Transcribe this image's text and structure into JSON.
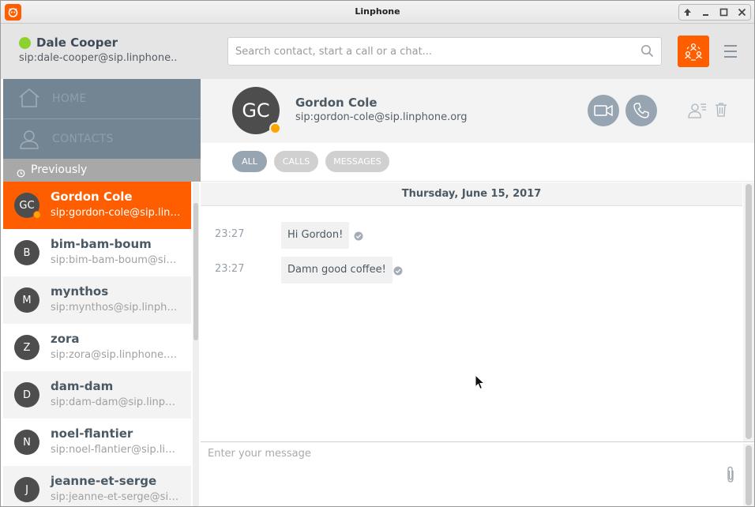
{
  "window": {
    "title": "Linphone"
  },
  "user": {
    "name": "Dale Cooper",
    "sip": "sip:dale-cooper@sip.linphone...."
  },
  "search": {
    "placeholder": "Search contact, start a call or a chat..."
  },
  "nav": {
    "home_label": "HOME",
    "contacts_label": "CONTACTS",
    "previously_label": "Previously"
  },
  "contacts": [
    {
      "initials": "GC",
      "name": "Gordon Cole",
      "sip": "sip:gordon-cole@sip.linphone.org",
      "selected": true
    },
    {
      "initials": "B",
      "name": "bim-bam-boum",
      "sip": "sip:bim-bam-boum@sip.linphone.org"
    },
    {
      "initials": "M",
      "name": "mynthos",
      "sip": "sip:mynthos@sip.linphone.org"
    },
    {
      "initials": "Z",
      "name": "zora",
      "sip": "sip:zora@sip.linphone.org"
    },
    {
      "initials": "D",
      "name": "dam-dam",
      "sip": "sip:dam-dam@sip.linphone.org"
    },
    {
      "initials": "N",
      "name": "noel-flantier",
      "sip": "sip:noel-flantier@sip.linphone.org"
    },
    {
      "initials": "J",
      "name": "jeanne-et-serge",
      "sip": "sip:jeanne-et-serge@sip.linphone.org"
    }
  ],
  "conversation": {
    "initials": "GC",
    "name": "Gordon Cole",
    "sip": "sip:gordon-cole@sip.linphone.org",
    "filters": {
      "all": "ALL",
      "calls": "CALLS",
      "messages": "MESSAGES"
    },
    "date": "Thursday, June 15, 2017",
    "messages": [
      {
        "time": "23:27",
        "text": "Hi Gordon!"
      },
      {
        "time": "23:27",
        "text": "Damn good coffee!"
      }
    ]
  },
  "composer": {
    "placeholder": "Enter your message"
  },
  "icons": {
    "app": "linphone-logo-icon",
    "search": "search-icon",
    "conference": "conference-icon",
    "menu": "menu-icon",
    "home": "home-icon",
    "contacts": "contacts-icon",
    "history": "clock-icon",
    "video_call": "video-camera-icon",
    "call": "phone-icon",
    "contact_edit": "contact-edit-icon",
    "delete": "trash-icon",
    "delivered": "check-icon",
    "attach": "paperclip-icon"
  },
  "colors": {
    "accent": "#fe5e00",
    "presence_online": "#8dd12f",
    "presence_away": "#ffa500",
    "nav_bg": "#738593",
    "action_btn": "#96a5b1"
  }
}
